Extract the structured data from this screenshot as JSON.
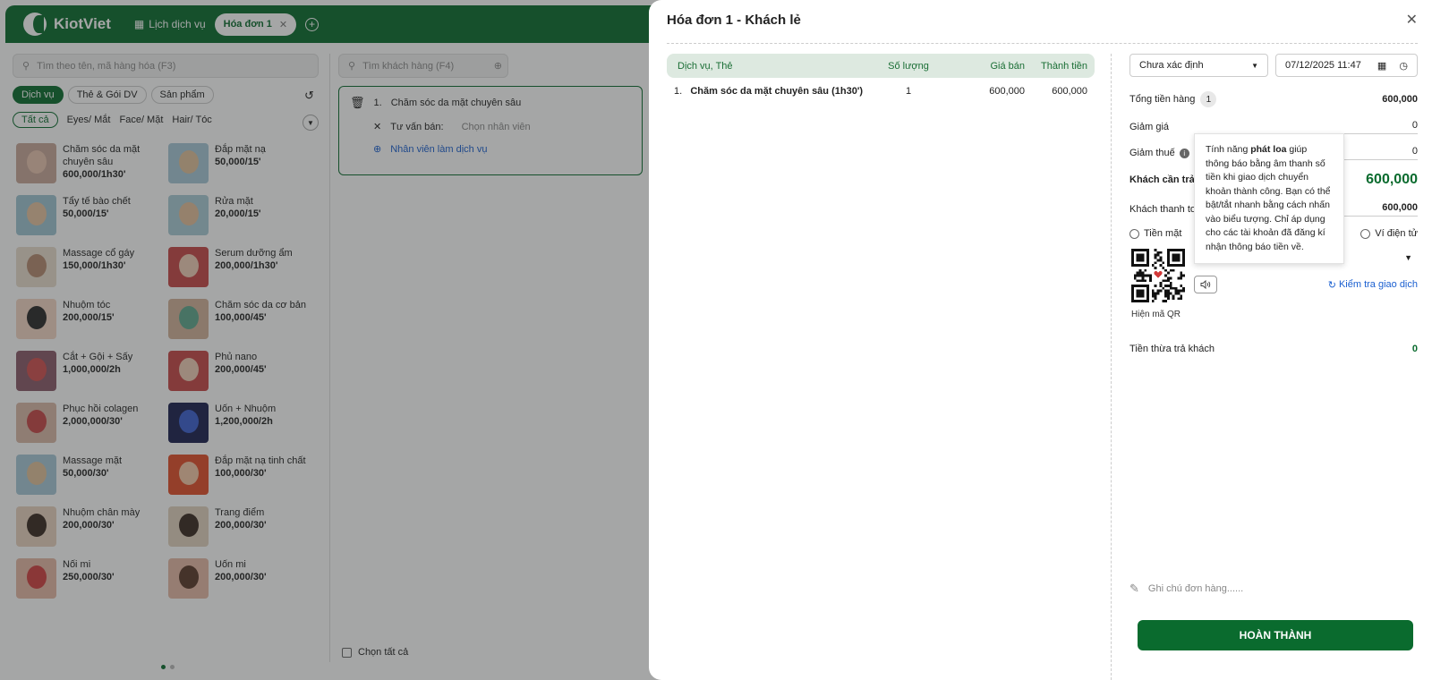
{
  "app": {
    "brand": "KiotViet",
    "nav_calendar": "Lịch dịch vụ",
    "tab_invoice": "Hóa đơn 1"
  },
  "product_search": {
    "placeholder": "Tìm theo tên, mã hàng hóa (F3)"
  },
  "customer_search": {
    "placeholder": "Tìm khách hàng (F4)"
  },
  "categories": [
    "Dịch vụ",
    "Thẻ & Gói DV",
    "Sản phẩm"
  ],
  "subcategories": [
    "Tất cả",
    "Eyes/ Mắt",
    "Face/ Mặt",
    "Hair/ Tóc"
  ],
  "products": [
    {
      "name": "Chăm sóc da mặt chuyên sâu",
      "price": "600,000/1h30'"
    },
    {
      "name": "Đắp mặt nạ",
      "price": "50,000/15'"
    },
    {
      "name": "Tẩy tế bào chết",
      "price": "50,000/15'"
    },
    {
      "name": "Rửa mặt",
      "price": "20,000/15'"
    },
    {
      "name": "Massage cổ gáy",
      "price": "150,000/1h30'"
    },
    {
      "name": "Serum dưỡng ẩm",
      "price": "200,000/1h30'"
    },
    {
      "name": "Nhuộm tóc",
      "price": "200,000/15'"
    },
    {
      "name": "Chăm sóc da cơ bản",
      "price": "100,000/45'"
    },
    {
      "name": "Cắt + Gội + Sấy",
      "price": "1,000,000/2h"
    },
    {
      "name": "Phủ nano",
      "price": "200,000/45'"
    },
    {
      "name": "Phục hồi colagen",
      "price": "2,000,000/30'"
    },
    {
      "name": "Uốn + Nhuộm",
      "price": "1,200,000/2h"
    },
    {
      "name": "Massage mặt",
      "price": "50,000/30'"
    },
    {
      "name": "Đắp mặt nạ tinh chất",
      "price": "100,000/30'"
    },
    {
      "name": "Nhuộm chân mày",
      "price": "200,000/30'"
    },
    {
      "name": "Trang điểm",
      "price": "200,000/30'"
    },
    {
      "name": "Nối mi",
      "price": "250,000/30'"
    },
    {
      "name": "Uốn mi",
      "price": "200,000/30'"
    }
  ],
  "cart": {
    "item_index": "1.",
    "item_name": "Chăm sóc da mặt chuyên sâu",
    "consultant_label": "Tư vấn bán:",
    "consultant_placeholder": "Chọn nhân viên",
    "add_staff": "Nhân viên làm dịch vụ",
    "select_all": "Chọn tất cả"
  },
  "modal": {
    "title": "Hóa đơn 1 - Khách lẻ",
    "table": {
      "headers": [
        "Dịch vụ, Thẻ",
        "Số lượng",
        "Giá bán",
        "Thành tiền"
      ],
      "rows": [
        {
          "index": "1.",
          "name": "Chăm sóc da mặt chuyên sâu (1h30')",
          "qty": "1",
          "price": "600,000",
          "total": "600,000"
        }
      ]
    },
    "staff_select": "Chưa xác định",
    "datetime": "07/12/2025 11:47",
    "total_goods_label": "Tổng tiền hàng",
    "total_goods_count": "1",
    "total_goods_value": "600,000",
    "discount_label": "Giảm giá",
    "discount_value": "0",
    "tax_label": "Giảm thuế",
    "tax_value": "0",
    "pay_label": "Khách cần trả",
    "pay_value": "600,000",
    "paid_label": "Khách thanh to",
    "paid_value": "600,000",
    "method_cash": "Tiền mặt",
    "method_wallet": "Ví điện tử",
    "qr_caption": "Hiện mã QR",
    "check_transaction": "Kiểm tra giao dịch",
    "change_label": "Tiền thừa trả khách",
    "change_value": "0",
    "note_placeholder": "Ghi chú đơn hàng......",
    "finish_button": "HOÀN THÀNH"
  },
  "tooltip": {
    "prefix": "Tính năng ",
    "bold": "phát loa",
    "suffix": " giúp thông báo bằng âm thanh số tiền khi giao dịch chuyển khoản thành công. Bạn có thể bật/tắt nhanh bằng cách nhấn vào biểu tượng. Chỉ áp dụng cho các tài khoản đã đăng kí nhận thông báo tiền về."
  },
  "colors": {
    "brand_green": "#0a6b2e",
    "header_tint": "#dde9e0",
    "link_blue": "#1a5fd0"
  }
}
